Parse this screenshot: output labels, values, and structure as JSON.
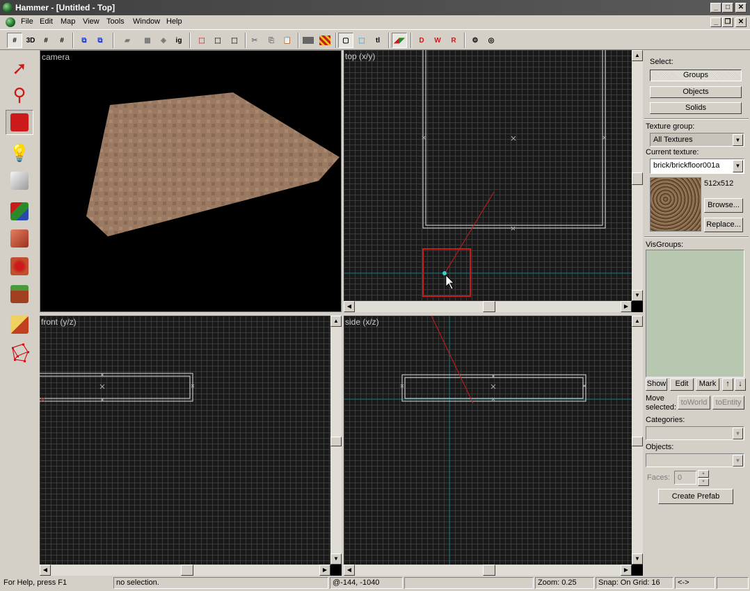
{
  "window": {
    "title": "Hammer - [Untitled - Top]"
  },
  "menu": [
    "File",
    "Edit",
    "Map",
    "View",
    "Tools",
    "Window",
    "Help"
  ],
  "toolbar": {
    "btn_3d": "3D",
    "btn_ig": "ig",
    "btn_tl": "tl"
  },
  "views": {
    "camera": "camera",
    "top": "top (x/y)",
    "front": "front (y/z)",
    "side": "side (x/z)"
  },
  "panel": {
    "select_label": "Select:",
    "groups": "Groups",
    "objects": "Objects",
    "solids": "Solids",
    "texture_group_label": "Texture group:",
    "texture_group": "All Textures",
    "current_texture_label": "Current texture:",
    "current_texture": "brick/brickfloor001a",
    "texture_size": "512x512",
    "browse": "Browse...",
    "replace": "Replace...",
    "visgroups_label": "VisGroups:",
    "show": "Show",
    "edit": "Edit",
    "mark": "Mark",
    "move_selected": "Move selected:",
    "to_world": "toWorld",
    "to_entity": "toEntity",
    "categories_label": "Categories:",
    "objects_label": "Objects:",
    "faces_label": "Faces:",
    "faces_value": "0",
    "create_prefab": "Create Prefab"
  },
  "status": {
    "help": "For Help, press F1",
    "selection": "no selection.",
    "coords": "@-144, -1040",
    "zoom": "Zoom: 0.25",
    "snap": "Snap: On Grid: 16",
    "arrows": "<->"
  },
  "colors": {
    "accent_red": "#cc1a1a",
    "axis_cyan": "#0a6e6e",
    "visgroup_bg": "#b8c8b0"
  }
}
